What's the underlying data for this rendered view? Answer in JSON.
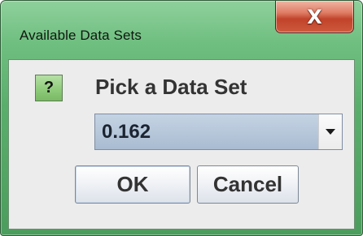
{
  "window": {
    "title": "Available Data Sets",
    "close_label": "X"
  },
  "dialog": {
    "icon": "question-icon",
    "icon_glyph": "?",
    "prompt": "Pick a Data Set",
    "selected_value": "0.162"
  },
  "buttons": {
    "ok_label": "OK",
    "cancel_label": "Cancel"
  },
  "colors": {
    "frame_green": "#5aae6c",
    "close_red": "#c0432a",
    "content_bg": "#ececec",
    "combo_blue": "#b7c8db"
  }
}
